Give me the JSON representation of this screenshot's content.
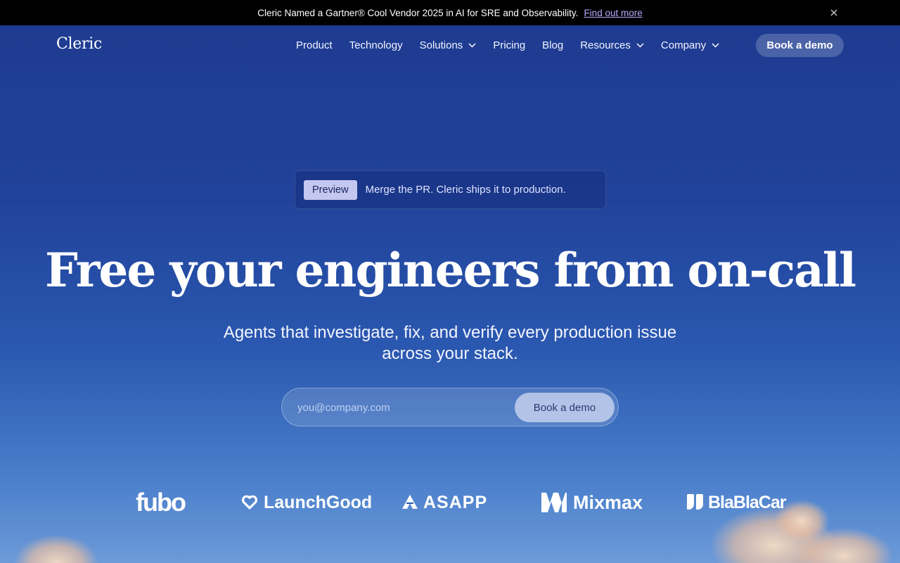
{
  "announcement": {
    "text": "Cleric Named a Gartner® Cool Vendor 2025 in AI for SRE and Observability.",
    "link": "Find out more"
  },
  "brand": {
    "name": "Cleric"
  },
  "nav": {
    "items": [
      {
        "label": "Product"
      },
      {
        "label": "Technology"
      },
      {
        "label": "Solutions"
      },
      {
        "label": "Pricing"
      },
      {
        "label": "Blog"
      },
      {
        "label": "Resources"
      },
      {
        "label": "Company"
      }
    ],
    "cta": "Book a demo"
  },
  "hero": {
    "badge": "Preview",
    "tagline": "Merge the PR. Cleric ships it to production.",
    "headline": "Free your engineers from on-call",
    "subhead": "Agents that investigate, fix, and verify every production issue across your stack.",
    "email_placeholder": "you@company.com",
    "form_button": "Book a demo"
  },
  "customers": {
    "logos": [
      "fubo",
      "LaunchGood",
      "ASAPP",
      "Mixmax",
      "BlaBlaCar"
    ]
  },
  "colors": {
    "background_top": "#1e3a8f",
    "background_bottom": "#6d9ad8",
    "announcement_bg": "#000000",
    "link": "#b9a9ff"
  },
  "icons": [
    "close-icon",
    "chevron-down-icon",
    "launchgood-heart-icon",
    "asapp-mark-icon",
    "mixmax-mark-icon",
    "blablacar-quote-icon"
  ]
}
